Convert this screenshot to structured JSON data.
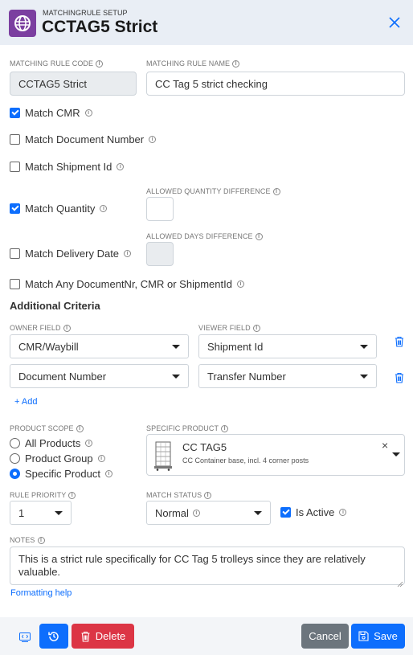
{
  "header": {
    "subtitle": "MATCHINGRULE SETUP",
    "title": "CCTAG5 Strict"
  },
  "colors": {
    "accent": "#0d6efd",
    "brand": "#7b3fa0",
    "danger": "#dc3545",
    "secondary": "#6c757d"
  },
  "form": {
    "code_label": "MATCHING RULE CODE",
    "code_value": "CCTAG5 Strict",
    "name_label": "MATCHING RULE NAME",
    "name_value": "CC Tag 5 strict checking",
    "match_cmr": {
      "label": "Match CMR",
      "checked": true
    },
    "match_doc": {
      "label": "Match Document Number",
      "checked": false
    },
    "match_shipment": {
      "label": "Match Shipment Id",
      "checked": false
    },
    "match_qty": {
      "label": "Match Quantity",
      "checked": true
    },
    "qty_diff_label": "ALLOWED QUANTITY DIFFERENCE",
    "qty_diff_value": "",
    "match_delivery": {
      "label": "Match Delivery Date",
      "checked": false
    },
    "days_diff_label": "ALLOWED DAYS DIFFERENCE",
    "days_diff_value": "",
    "match_any": {
      "label": "Match Any DocumentNr, CMR or ShipmentId",
      "checked": false
    }
  },
  "criteria": {
    "title": "Additional Criteria",
    "owner_label": "OWNER FIELD",
    "viewer_label": "VIEWER FIELD",
    "rows": [
      {
        "owner": "CMR/Waybill",
        "viewer": "Shipment Id"
      },
      {
        "owner": "Document Number",
        "viewer": "Transfer Number"
      }
    ],
    "add_label": "+ Add"
  },
  "scope": {
    "label": "PRODUCT SCOPE",
    "options": [
      "All Products",
      "Product Group",
      "Specific Product"
    ],
    "selected": "Specific Product",
    "specific_label": "SPECIFIC PRODUCT",
    "product_name": "CC TAG5",
    "product_desc": "CC Container base, incl. 4 corner posts",
    "clear_icon": "×"
  },
  "priority": {
    "label": "RULE PRIORITY",
    "value": "1"
  },
  "status": {
    "label": "MATCH STATUS",
    "value": "Normal",
    "active_label": "Is Active",
    "active": true
  },
  "notes": {
    "label": "NOTES",
    "value": "This is a strict rule specifically for CC Tag 5 trolleys since they are relatively valuable.",
    "help_link": "Formatting help"
  },
  "footer": {
    "delete_label": "Delete",
    "cancel_label": "Cancel",
    "save_label": "Save"
  }
}
